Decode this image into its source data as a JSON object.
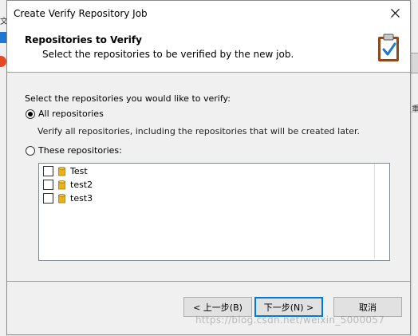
{
  "window": {
    "title": "Create Verify Repository Job"
  },
  "header": {
    "title": "Repositories to Verify",
    "subtitle": "Select the repositories to be verified by the new job."
  },
  "content": {
    "prompt": "Select the repositories you would like to verify:",
    "option_all": {
      "label": "All repositories",
      "selected": true
    },
    "option_all_description": "Verify all repositories, including the repositories that will be created later.",
    "option_these": {
      "label": "These repositories:",
      "selected": false
    },
    "repositories": [
      {
        "name": "Test",
        "checked": false
      },
      {
        "name": "test2",
        "checked": false
      },
      {
        "name": "test3",
        "checked": false
      }
    ]
  },
  "footer": {
    "back_label": "< 上一步(B)",
    "next_label": "下一步(N) >",
    "cancel_label": "取消"
  },
  "watermark": "https://blog.csdn.net/weixin_5000057",
  "colors": {
    "accent": "#0078d7",
    "db_icon": "#e8b21a",
    "check": "#1e77d3"
  }
}
